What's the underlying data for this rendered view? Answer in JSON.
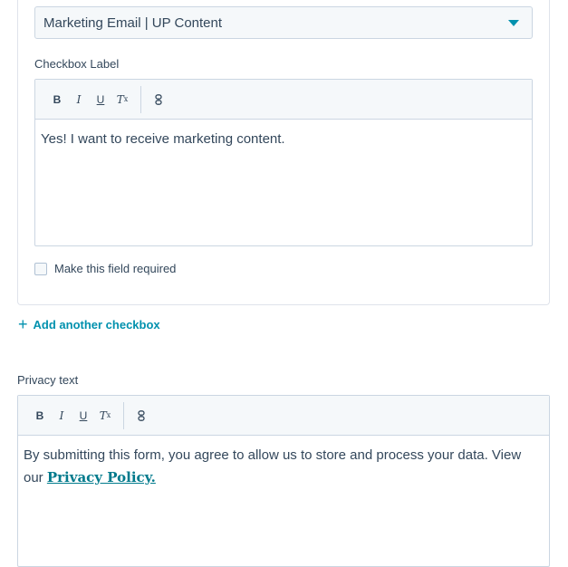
{
  "subscription": {
    "selected_value": "Marketing Email | UP Content"
  },
  "checkbox_editor": {
    "label": "Checkbox Label",
    "toolbar": {
      "bold": "B",
      "italic": "I",
      "underline": "U",
      "clear_format": "T",
      "clear_format_sub": "x"
    },
    "content": "Yes! I want to receive marketing content."
  },
  "required_checkbox": {
    "label": "Make this field required",
    "checked": false
  },
  "add_checkbox": {
    "icon": "+",
    "label": "Add another checkbox"
  },
  "privacy_editor": {
    "label": "Privacy text",
    "toolbar": {
      "bold": "B",
      "italic": "I",
      "underline": "U",
      "clear_format": "T",
      "clear_format_sub": "x"
    },
    "content_text": "By submitting this form, you agree to allow us to store and process your data. View our",
    "link_text": "Privacy Policy."
  },
  "colors": {
    "accent": "#0091ae",
    "text": "#33475b",
    "border": "#cbd6e2",
    "toolbar_bg": "#f5f8fa"
  }
}
